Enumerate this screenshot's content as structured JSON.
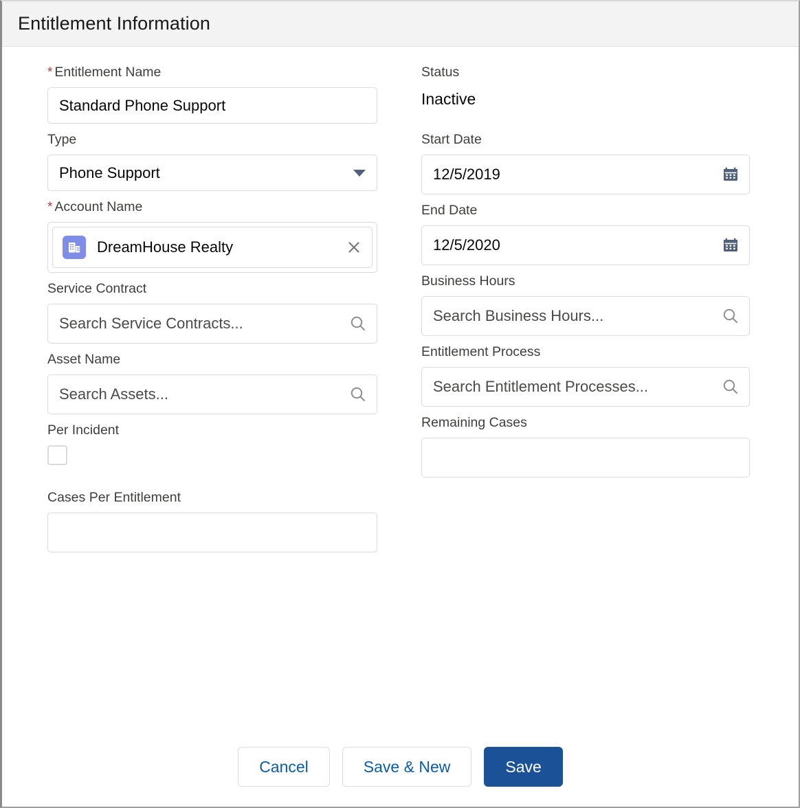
{
  "header": {
    "title": "Entitlement Information"
  },
  "colors": {
    "header_bg": "#f3f3f3",
    "brand_blue": "#1b5297",
    "link_blue": "#0b5cab",
    "required_red": "#b23b38",
    "account_icon_bg": "#7f8ce8",
    "calendar_icon": "#51607b",
    "border": "#dddbda"
  },
  "fields": {
    "entitlement_name": {
      "label": "Entitlement Name",
      "required": true,
      "value": "Standard Phone Support"
    },
    "type": {
      "label": "Type",
      "required": false,
      "value": "Phone Support",
      "icon": "chevron-down-icon"
    },
    "account_name": {
      "label": "Account Name",
      "required": true,
      "value": "DreamHouse Realty",
      "record_icon": "account-building-icon",
      "remove_icon": "close-icon"
    },
    "service_contract": {
      "label": "Service Contract",
      "required": false,
      "value": "",
      "placeholder": "Search Service Contracts...",
      "icon": "search-icon"
    },
    "asset_name": {
      "label": "Asset Name",
      "required": false,
      "value": "",
      "placeholder": "Search Assets...",
      "icon": "search-icon"
    },
    "per_incident": {
      "label": "Per Incident",
      "required": false,
      "checked": false
    },
    "cases_per_entitlement": {
      "label": "Cases Per Entitlement",
      "required": false,
      "value": ""
    },
    "status": {
      "label": "Status",
      "required": false,
      "value": "Inactive"
    },
    "start_date": {
      "label": "Start Date",
      "required": false,
      "value": "12/5/2019",
      "icon": "calendar-icon"
    },
    "end_date": {
      "label": "End Date",
      "required": false,
      "value": "12/5/2020",
      "icon": "calendar-icon"
    },
    "business_hours": {
      "label": "Business Hours",
      "required": false,
      "value": "",
      "placeholder": "Search Business Hours...",
      "icon": "search-icon"
    },
    "entitlement_process": {
      "label": "Entitlement Process",
      "required": false,
      "value": "",
      "placeholder": "Search Entitlement Processes...",
      "icon": "search-icon"
    },
    "remaining_cases": {
      "label": "Remaining Cases",
      "required": false,
      "value": ""
    }
  },
  "footer": {
    "cancel_label": "Cancel",
    "save_new_label": "Save & New",
    "save_label": "Save"
  }
}
